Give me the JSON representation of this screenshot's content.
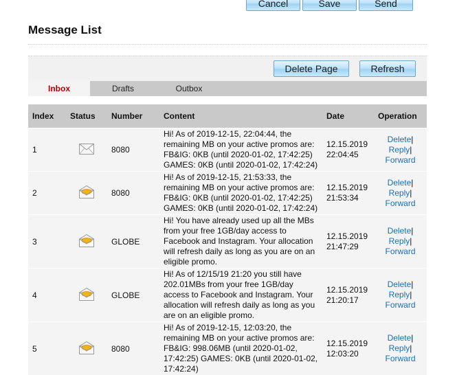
{
  "top_buttons": {
    "cancel": "Cancel",
    "save": "Save",
    "send": "Send"
  },
  "page": {
    "title": "Message List"
  },
  "toolbar": {
    "delete_page": "Delete Page",
    "refresh": "Refresh"
  },
  "tabs": [
    {
      "label": "Inbox",
      "active": true
    },
    {
      "label": "Drafts",
      "active": false
    },
    {
      "label": "Outbox",
      "active": false
    }
  ],
  "table": {
    "headers": [
      "Index",
      "Status",
      "Number",
      "Content",
      "Date",
      "Operation"
    ],
    "rows": [
      {
        "index": "1",
        "status": "read",
        "number": "8080",
        "content": "Hi! As of 2019-12-15, 22:04:44, the remaining MB on your active promos are: FB&IG: 0KB (until 2020-01-02, 17:42:25) GAMES: 0KB (until 2020-01-02, 17:42:24)",
        "date": "12.15.2019",
        "time": "22:04:45"
      },
      {
        "index": "2",
        "status": "unread",
        "number": "8080",
        "content": "Hi! As of 2019-12-15, 21:53:33, the remaining MB on your active promos are: FB&IG: 0KB (until 2020-01-02, 17:42:25) GAMES: 0KB (until 2020-01-02, 17:42:24)",
        "date": "12.15.2019",
        "time": "21:53:34"
      },
      {
        "index": "3",
        "status": "unread",
        "number": "GLOBE",
        "content": "Hi! You have already used up all the MBs from your free 1GB/day access to Facebook and Instagram. Your allocation will refresh daily as long as you are on an eligible promo.",
        "date": "12.15.2019",
        "time": "21:47:29"
      },
      {
        "index": "4",
        "status": "unread",
        "number": "GLOBE",
        "content": "Hi! As of 12/15/19 21:20 you still have 202.01MBs from your free 1GB/day access to Facebook and Instagram. Your allocation will refresh daily as long as you are on an eligible promo.",
        "date": "12.15.2019",
        "time": "21:20:17"
      },
      {
        "index": "5",
        "status": "unread",
        "number": "8080",
        "content": "Hi! As of 2019-12-15, 12:03:20, the remaining MB on your active promos are: FB&IG: 998.06MB (until 2020-01-02, 17:42:25) GAMES: 0KB (until 2020-01-02, 17:42:24)",
        "date": "12.15.2019",
        "time": "12:03:20"
      }
    ],
    "operations": {
      "delete": "Delete",
      "reply": "Reply",
      "forward": "Forward",
      "separator": "|"
    }
  },
  "colors": {
    "accent_tab": "#b00000",
    "link": "#1a6fb8",
    "header_bg": "#c9c9c9",
    "row_bg": "#f4f4f4",
    "button_blue": "#9fd4f5"
  },
  "icons": {
    "read": "envelope-open-icon",
    "unread": "envelope-unread-icon"
  }
}
